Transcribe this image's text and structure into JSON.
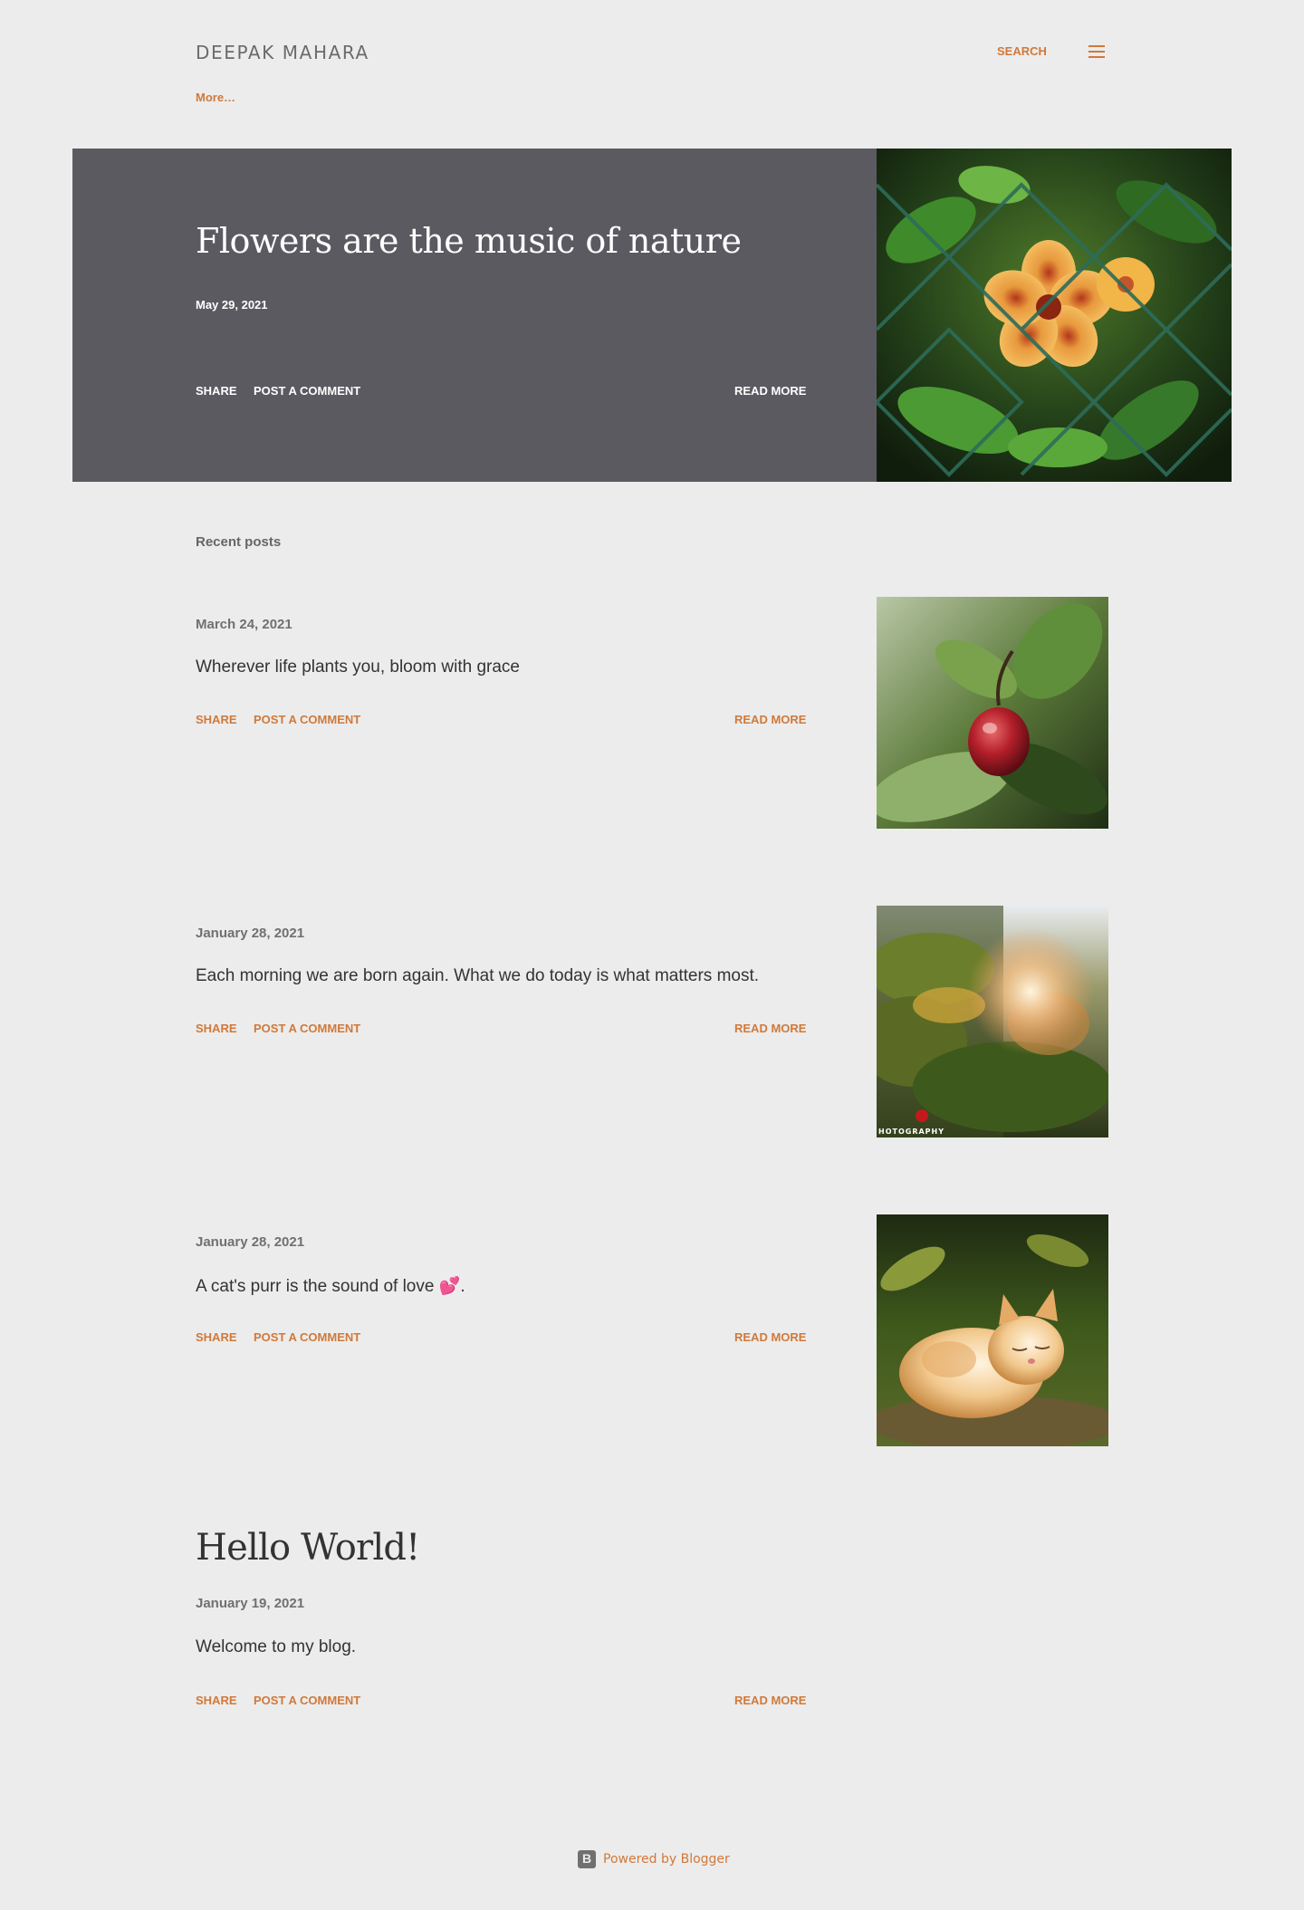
{
  "header": {
    "site_title": "DEEPAK MAHARA",
    "search_label": "SEARCH",
    "menu_icon": "hamburger-menu-icon",
    "more_label": "More…"
  },
  "featured": {
    "title": "Flowers are the music of nature",
    "date": "May 29, 2021",
    "share_label": "SHARE",
    "comment_label": "POST A COMMENT",
    "read_more_label": "READ MORE"
  },
  "recent": {
    "title": "Recent posts",
    "posts": [
      {
        "date": "March 24, 2021",
        "title": "Wherever life plants you, bloom with grace",
        "share_label": "SHARE",
        "comment_label": "POST A COMMENT",
        "read_more_label": "READ MORE"
      },
      {
        "date": "January 28, 2021",
        "title": "Each morning we are born again.  What we do today is what matters most.",
        "share_label": "SHARE",
        "comment_label": "POST A COMMENT",
        "read_more_label": "READ MORE",
        "watermark": "HOTOGRAPHY"
      },
      {
        "date": "January 28, 2021",
        "title": " A cat's purr is the sound of love 💕.",
        "share_label": "SHARE",
        "comment_label": "POST A COMMENT",
        "read_more_label": "READ MORE"
      }
    ]
  },
  "hello": {
    "title": "Hello World!",
    "date": "January 19, 2021",
    "snippet": "Welcome to my blog.",
    "share_label": "SHARE",
    "comment_label": "POST A COMMENT",
    "read_more_label": "READ MORE"
  },
  "footer": {
    "powered_label": "Powered by Blogger",
    "icon": "blogger-icon"
  },
  "colors": {
    "background": "#ececec",
    "accent": "#d0793a",
    "featured_bg": "#5b5a61",
    "text": "#333333"
  }
}
